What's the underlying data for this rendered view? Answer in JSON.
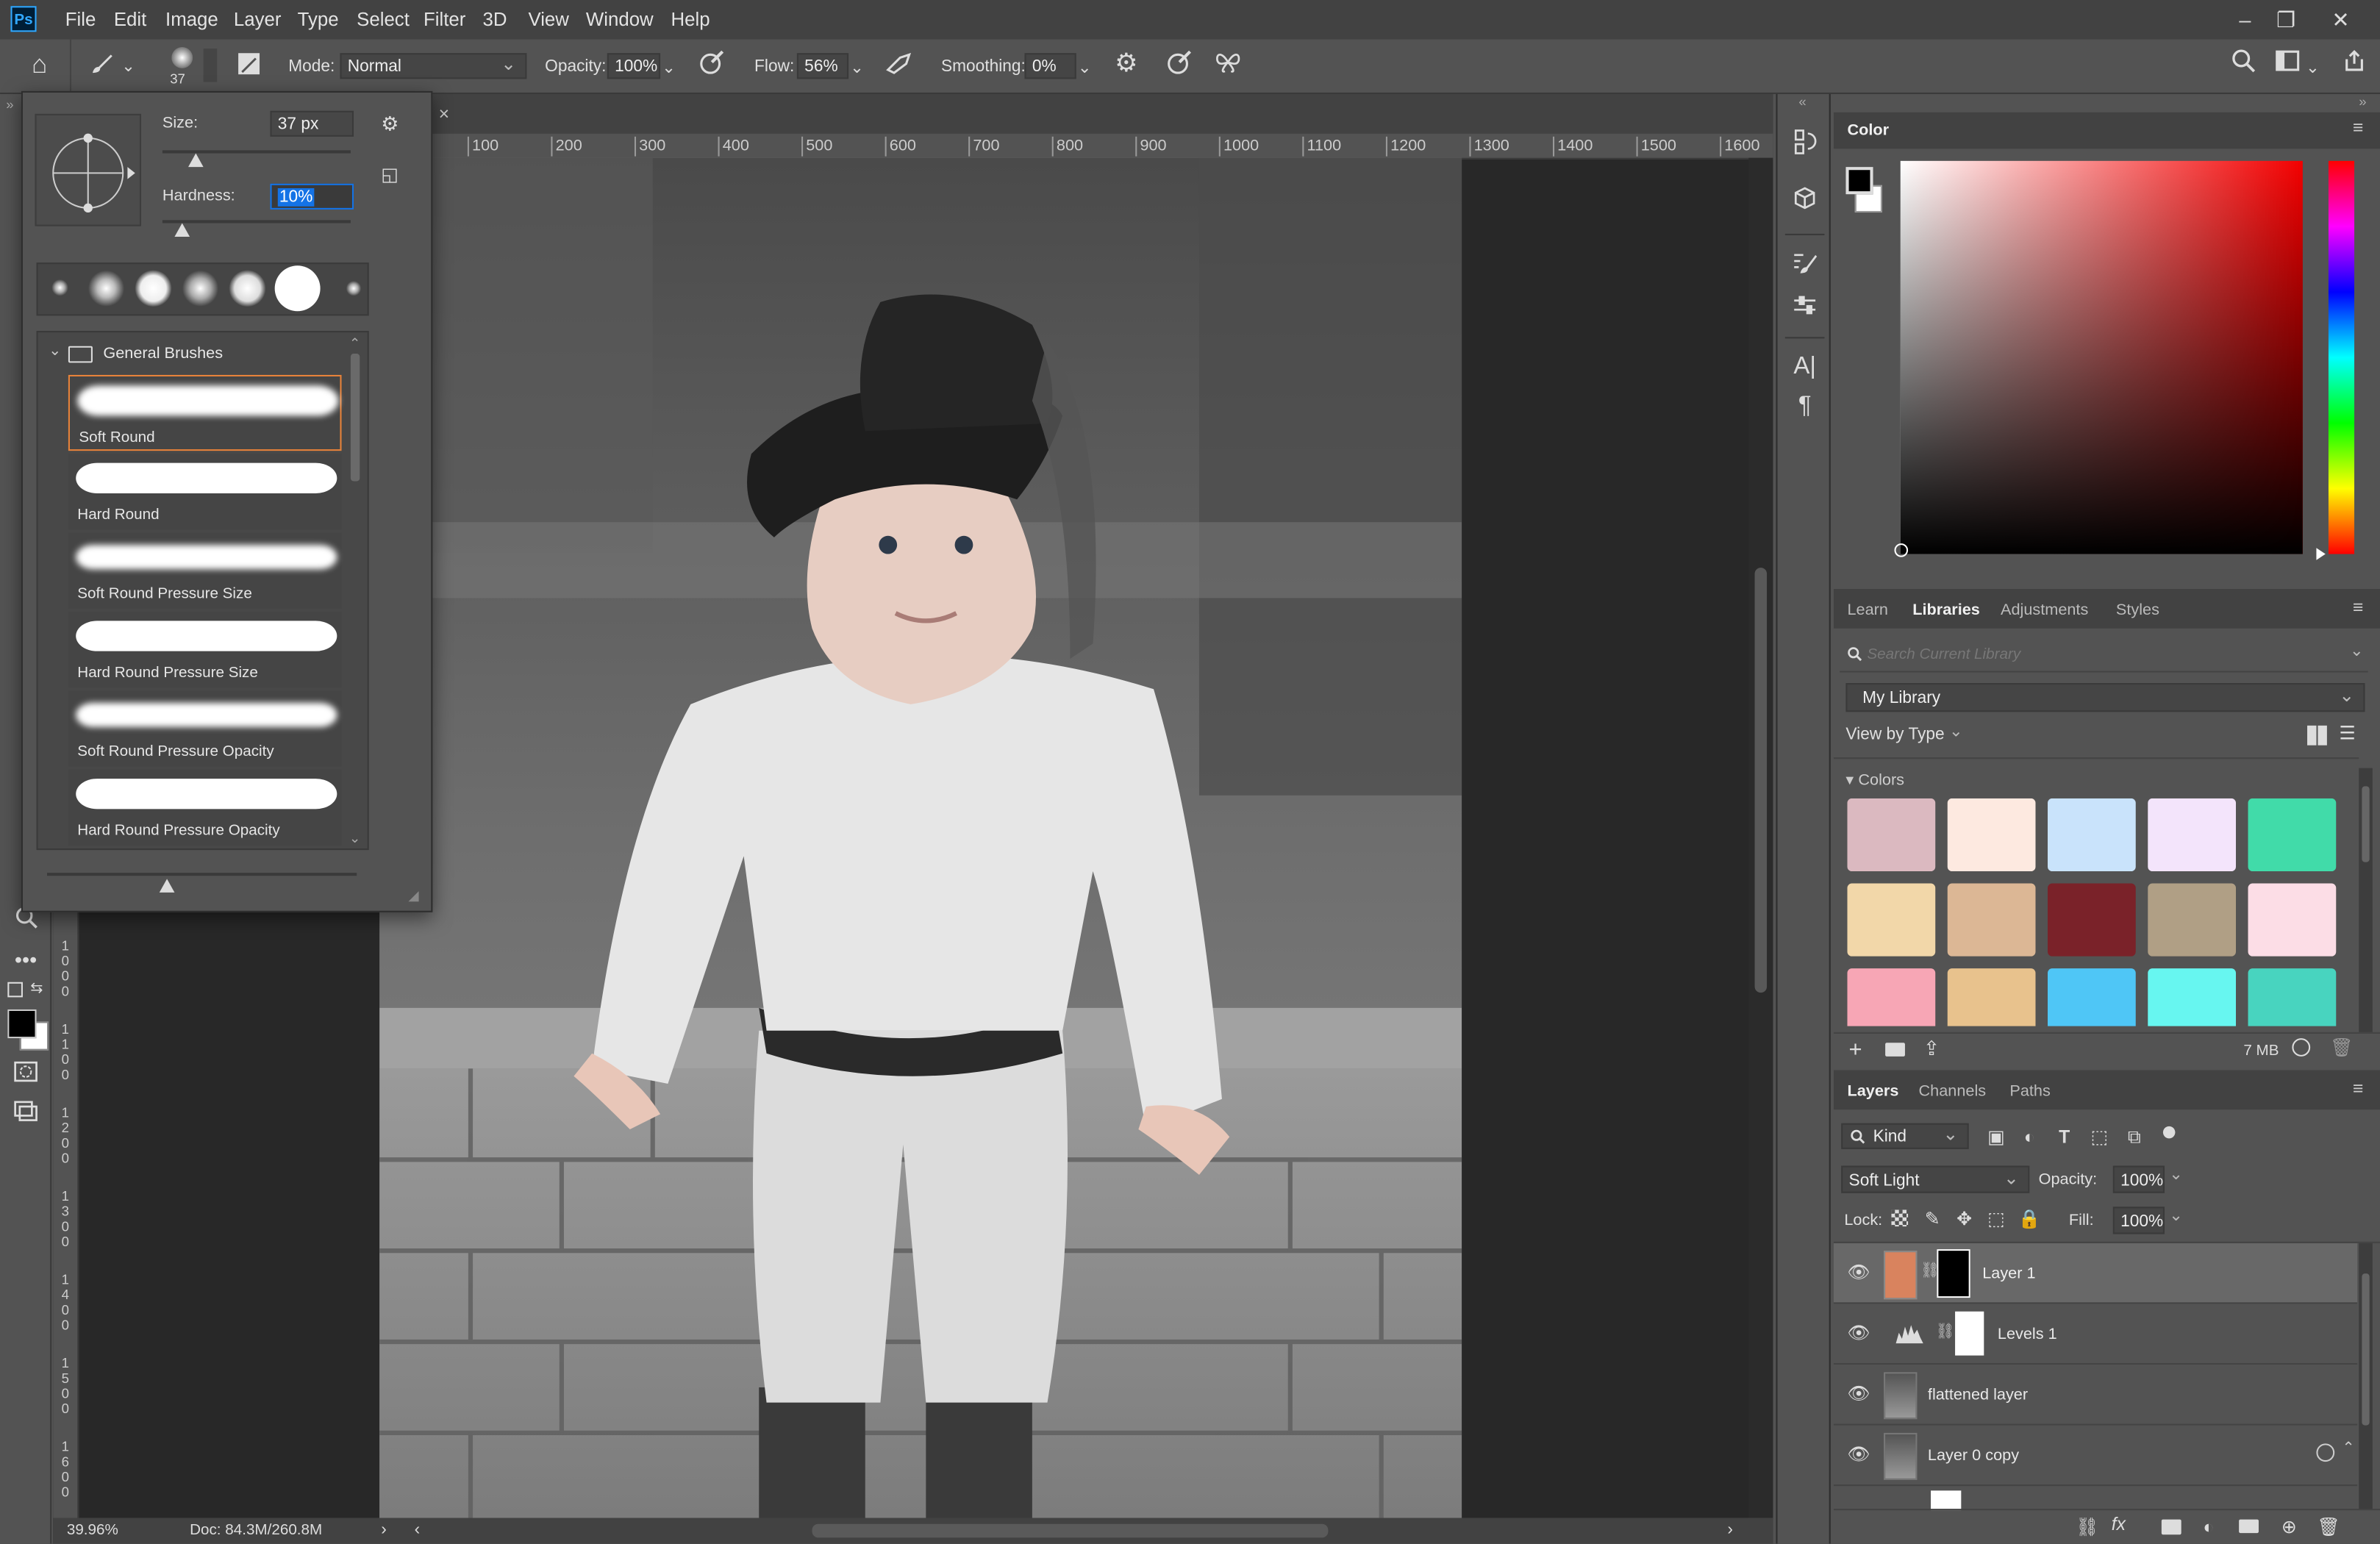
{
  "app": {
    "logo": "Ps"
  },
  "menu": [
    "File",
    "Edit",
    "Image",
    "Layer",
    "Type",
    "Select",
    "Filter",
    "3D",
    "View",
    "Window",
    "Help"
  ],
  "window_controls": {
    "minimize": "–",
    "restore": "❐",
    "close": "✕"
  },
  "options": {
    "brush_size_badge": "37",
    "mode_label": "Mode:",
    "mode_value": "Normal",
    "opacity_label": "Opacity:",
    "opacity_value": "100%",
    "flow_label": "Flow:",
    "flow_value": "56%",
    "smoothing_label": "Smoothing:",
    "smoothing_value": "0%"
  },
  "brush_popup": {
    "size_label": "Size:",
    "size_value": "37 px",
    "hardness_label": "Hardness:",
    "hardness_value": "10%",
    "folder_name": "General Brushes",
    "brushes": [
      "Soft Round",
      "Hard Round",
      "Soft Round Pressure Size",
      "Hard Round Pressure Size",
      "Soft Round Pressure Opacity",
      "Hard Round Pressure Opacity"
    ]
  },
  "ruler": {
    "h_ticks": [
      "100",
      "200",
      "300",
      "400",
      "500",
      "600",
      "700",
      "800",
      "900",
      "1000",
      "1100",
      "1200",
      "1300",
      "1400",
      "1500",
      "1600"
    ],
    "v_ticks": [
      "1000",
      "1100",
      "1200",
      "1300",
      "1400",
      "1500",
      "1600"
    ]
  },
  "status": {
    "zoom": "39.96%",
    "doc": "Doc: 84.3M/260.8M"
  },
  "color_panel": {
    "title": "Color",
    "fg": "#000000",
    "bg": "#ffffff"
  },
  "library": {
    "tabs": [
      "Learn",
      "Libraries",
      "Adjustments",
      "Styles"
    ],
    "active_tab": "Libraries",
    "search_placeholder": "Search Current Library",
    "library_name": "My Library",
    "view_by": "View by Type",
    "section": "Colors",
    "swatches": [
      "#dbb9c0",
      "#fde9e0",
      "#c9e3fb",
      "#f3e4fb",
      "#41dba9",
      "#f2d7a9",
      "#dcb795",
      "#7a2229",
      "#b09f85",
      "#fcdde6",
      "#f7a6b5",
      "#e8c28d",
      "#4fc6f6",
      "#67f6f0",
      "#48d4bf"
    ],
    "size": "7 MB"
  },
  "layers": {
    "tabs": [
      "Layers",
      "Channels",
      "Paths"
    ],
    "active_tab": "Layers",
    "filter": "Kind",
    "blend_mode": "Soft Light",
    "opacity_label": "Opacity:",
    "opacity_value": "100%",
    "lock_label": "Lock:",
    "fill_label": "Fill:",
    "fill_value": "100%",
    "rows": [
      {
        "name": "Layer 1",
        "selected": true,
        "thumb_color": "#d9835e"
      },
      {
        "name": "Levels 1",
        "selected": false
      },
      {
        "name": "flattened layer",
        "selected": false
      },
      {
        "name": "Layer 0 copy",
        "selected": false
      }
    ]
  }
}
